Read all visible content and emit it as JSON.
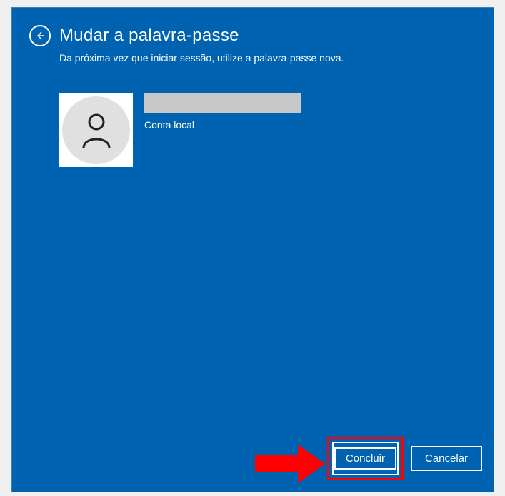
{
  "header": {
    "title": "Mudar a palavra-passe",
    "subtitle": "Da próxima vez que iniciar sessão, utilize a palavra-passe nova."
  },
  "user": {
    "username": "",
    "account_type": "Conta local"
  },
  "buttons": {
    "finish": "Concluir",
    "cancel": "Cancelar"
  }
}
